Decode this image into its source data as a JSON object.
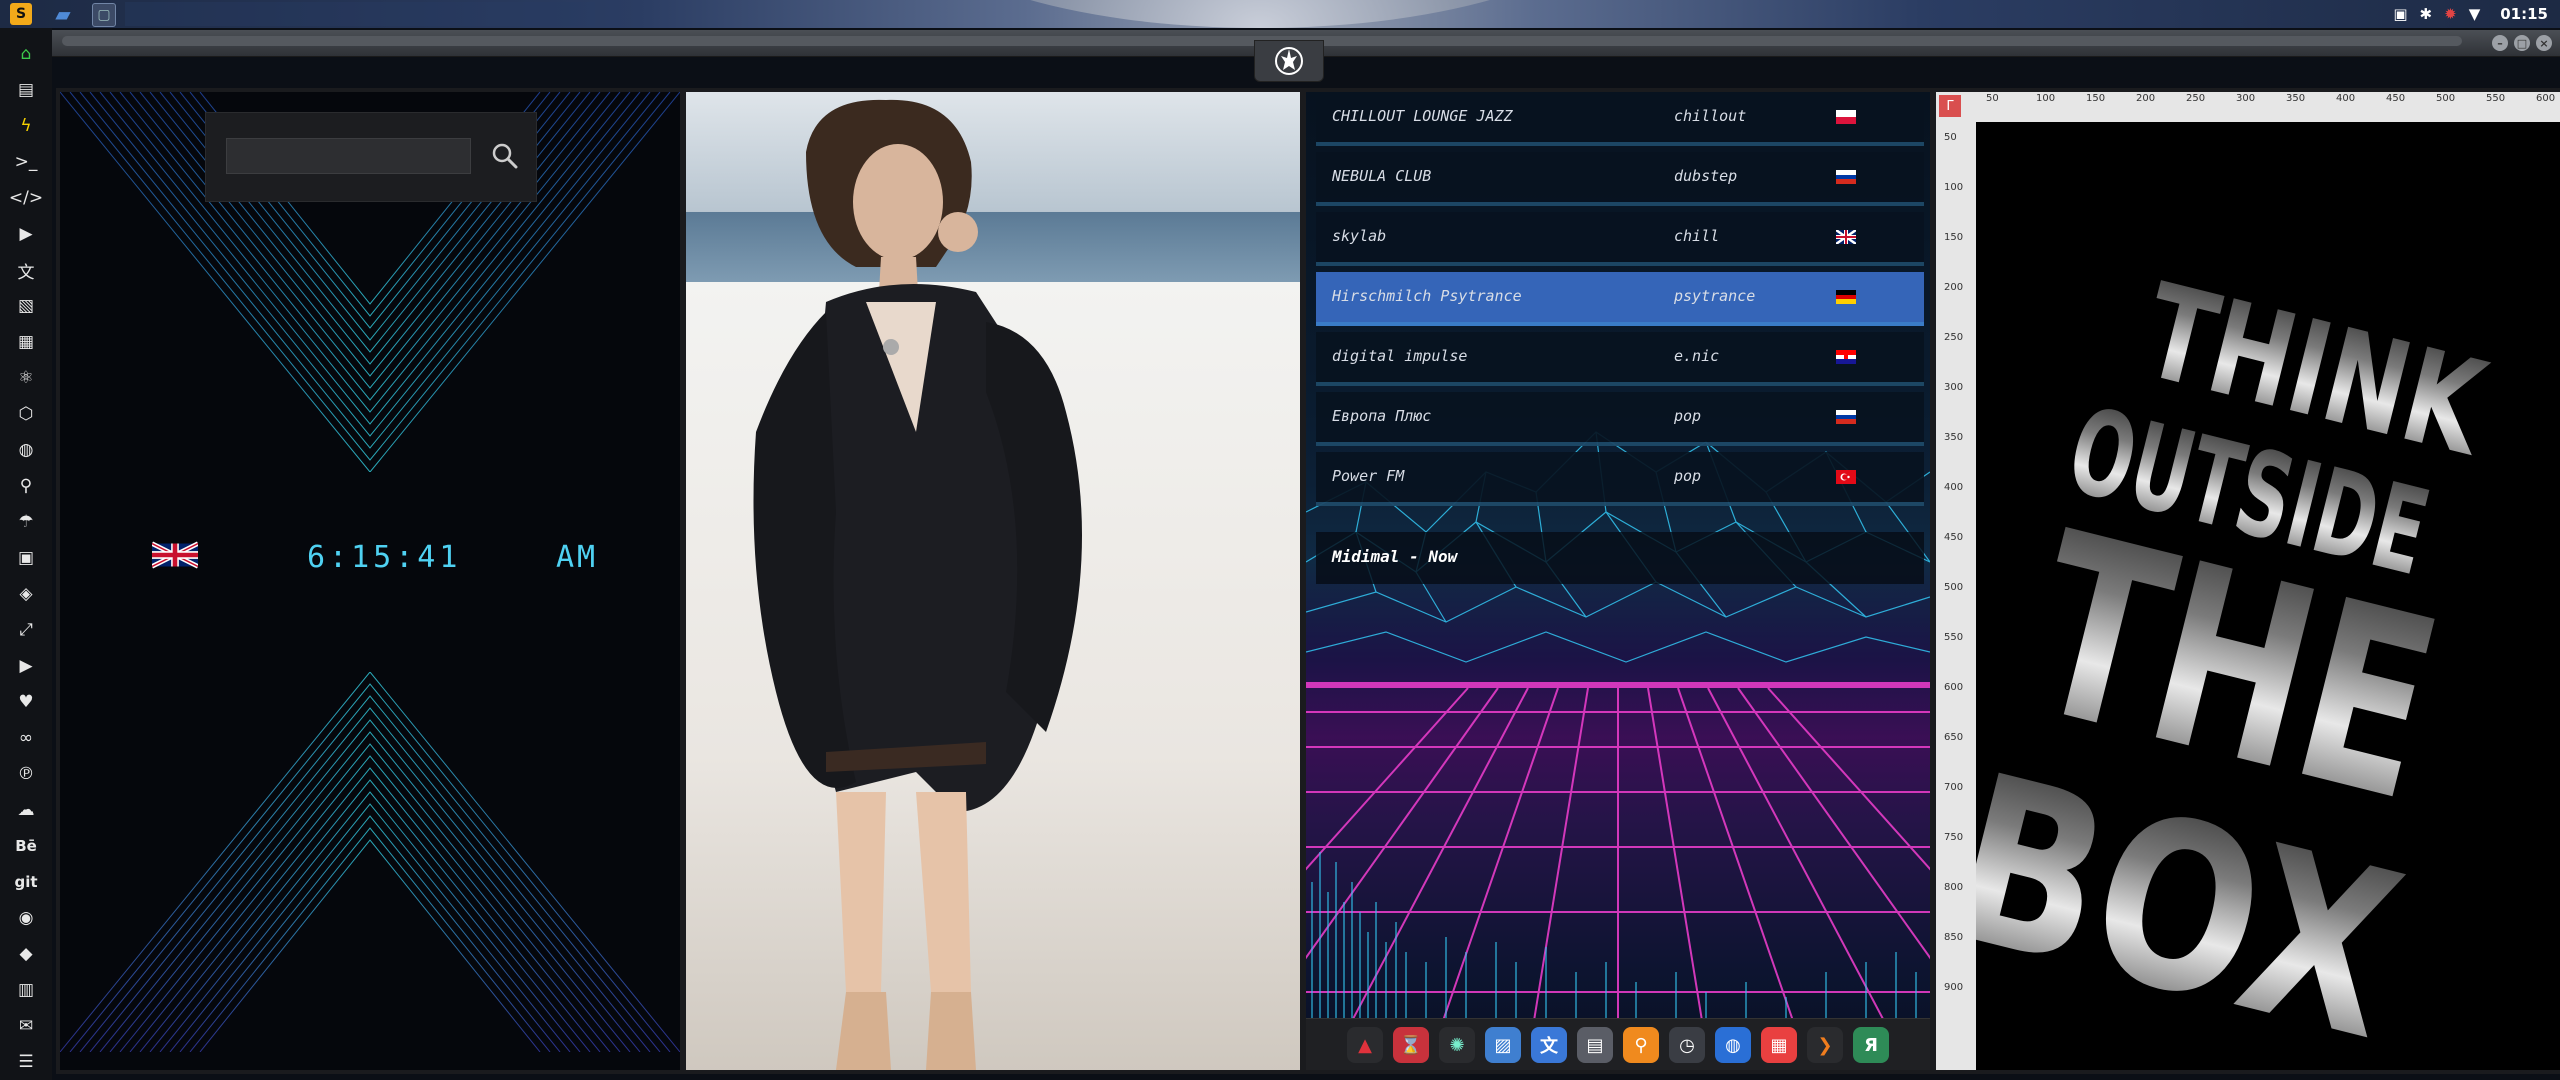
{
  "top_panel": {
    "clock": "01:15",
    "app_icons": [
      "sublime-icon",
      "folder-icon",
      "window-icon"
    ],
    "tray_icons": [
      "image-icon",
      "bluetooth-icon",
      "settings-red-icon",
      "wifi-icon"
    ]
  },
  "window": {
    "buttons": [
      "minimize",
      "maximize",
      "close"
    ],
    "emblem": "rebel-alliance-icon"
  },
  "dock": {
    "items": [
      {
        "icon": "home-icon",
        "glyph": "⌂",
        "color": "#3cc84b"
      },
      {
        "icon": "document-icon",
        "glyph": "▤"
      },
      {
        "icon": "lightning-icon",
        "glyph": "ϟ",
        "color": "#f5d000"
      },
      {
        "icon": "terminal-icon",
        "glyph": ">_"
      },
      {
        "icon": "code-icon",
        "glyph": "</>"
      },
      {
        "icon": "play-icon",
        "glyph": "▶"
      },
      {
        "icon": "translate-icon",
        "glyph": "文"
      },
      {
        "icon": "image-icon",
        "glyph": "▧"
      },
      {
        "icon": "news-icon",
        "glyph": "▦"
      },
      {
        "icon": "atom-icon",
        "glyph": "⚛"
      },
      {
        "icon": "hexagon-icon",
        "glyph": "⬡"
      },
      {
        "icon": "globe-icon",
        "glyph": "◍"
      },
      {
        "icon": "search-icon",
        "glyph": "⚲"
      },
      {
        "icon": "umbrella-icon",
        "glyph": "☂"
      },
      {
        "icon": "contacts-icon",
        "glyph": "▣"
      },
      {
        "icon": "ticket-icon",
        "glyph": "◈"
      },
      {
        "icon": "fullscreen-icon",
        "glyph": "⤢"
      },
      {
        "icon": "youtube-icon",
        "glyph": "▶"
      },
      {
        "icon": "heart-icon",
        "glyph": "♥"
      },
      {
        "icon": "creative-cloud-icon",
        "glyph": "∞"
      },
      {
        "icon": "pinterest-icon",
        "glyph": "℗"
      },
      {
        "icon": "cloud-icon",
        "glyph": "☁"
      },
      {
        "icon": "behance-icon",
        "label": "Bē"
      },
      {
        "icon": "git-icon",
        "label": "git"
      },
      {
        "icon": "github-icon",
        "glyph": "◉"
      },
      {
        "icon": "dropbox-icon",
        "glyph": "◆"
      },
      {
        "icon": "map-icon",
        "glyph": "▥"
      },
      {
        "icon": "mail-icon",
        "glyph": "✉"
      },
      {
        "icon": "list-icon",
        "glyph": "☰"
      }
    ]
  },
  "clock_widget": {
    "search_placeholder": "",
    "time": "6:15:41",
    "ampm": "AM",
    "flag": "uk-flag-icon"
  },
  "radio": {
    "stations": [
      {
        "name": "CHILLOUT LOUNGE JAZZ",
        "genre": "chillout",
        "flag": "poland",
        "selected": false
      },
      {
        "name": "NEBULA CLUB",
        "genre": "dubstep",
        "flag": "russia",
        "selected": false
      },
      {
        "name": "skylab",
        "genre": "chill",
        "flag": "uk",
        "selected": false
      },
      {
        "name": "Hirschmilch Psytrance",
        "genre": "psytrance",
        "flag": "germany",
        "selected": true
      },
      {
        "name": "digital impulse",
        "genre": "e.nic",
        "flag": "croatia",
        "selected": false
      },
      {
        "name": "Европа Плюс",
        "genre": "pop",
        "flag": "russia",
        "selected": false
      },
      {
        "name": "Power FM",
        "genre": "pop",
        "flag": "turkey",
        "selected": false
      }
    ],
    "now_playing": "Midimal - Now",
    "colors": {
      "selected": "#3565b8",
      "neon_pink": "#e63cc8",
      "neon_cyan": "#33c6f2"
    }
  },
  "launcher": {
    "icons": [
      {
        "name": "acrobat-icon",
        "glyph": "▲",
        "bg": "#2a2b2e",
        "color": "#e0323c"
      },
      {
        "name": "hourglass-icon",
        "glyph": "⌛",
        "bg": "#c8323c"
      },
      {
        "name": "blender-icon",
        "glyph": "✺",
        "bg": "#2a2b2e",
        "color": "#7ec"
      },
      {
        "name": "image-viewer-icon",
        "glyph": "▨",
        "bg": "#3f7fd0"
      },
      {
        "name": "translate-icon",
        "glyph": "文",
        "bg": "#3a78d8"
      },
      {
        "name": "calendar-sheet-icon",
        "glyph": "▤",
        "bg": "#5a5d66"
      },
      {
        "name": "search-app-icon",
        "glyph": "⚲",
        "bg": "#f08a1e"
      },
      {
        "name": "clock-app-icon",
        "glyph": "◷",
        "bg": "#3a3d44"
      },
      {
        "name": "browser-icon",
        "glyph": "◍",
        "bg": "#2a6fd6"
      },
      {
        "name": "calendar-icon",
        "glyph": "▦",
        "bg": "#e94040"
      },
      {
        "name": "arrow-icon",
        "glyph": "❯",
        "bg": "#2a2b2e",
        "color": "#f07d1e"
      },
      {
        "name": "yandex-icon",
        "glyph": "Я",
        "bg": "#2e8b57"
      }
    ]
  },
  "poster": {
    "words": [
      "THINK",
      "OUTSIDE",
      "THE",
      "BOX"
    ],
    "ruler_top": [
      "50",
      "100",
      "150",
      "200",
      "250",
      "300",
      "350",
      "400",
      "450",
      "500",
      "550",
      "600"
    ],
    "ruler_left": [
      "50",
      "100",
      "150",
      "200",
      "250",
      "300",
      "350",
      "400",
      "450",
      "500",
      "550",
      "600",
      "650",
      "700",
      "750",
      "800",
      "850",
      "900"
    ]
  }
}
